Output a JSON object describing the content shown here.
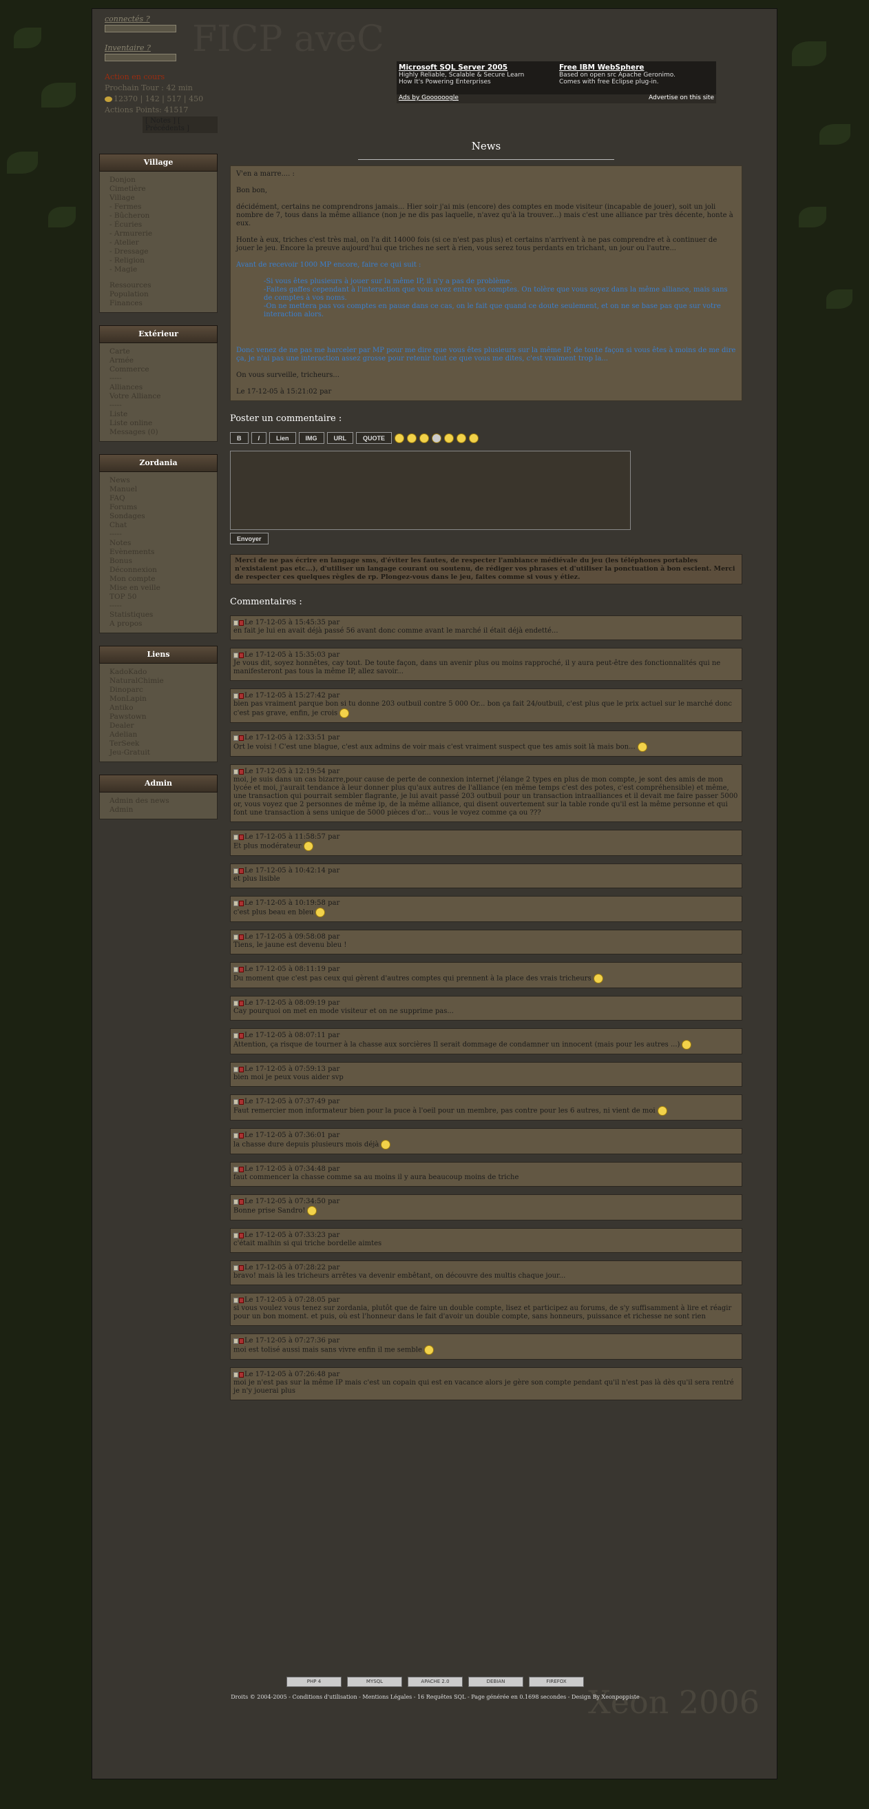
{
  "login": {
    "label1": "connectés ?",
    "label2": "Inventaire ?",
    "event": "Action en cours",
    "line1": "Prochain Tour : 42 min",
    "stats": "12370 | 142 | 517 | 450",
    "line3": "Actions Points: 41517",
    "notes": "[ Notes ] [ Précédents ]"
  },
  "banner": {
    "ad1_title": "Microsoft SQL Server 2005",
    "ad1_l1": "Highly Reliable, Scalable & Secure Learn",
    "ad1_l2": "How It's Powering Enterprises",
    "ad2_title": "Free IBM WebSphere",
    "ad2_l1": "Based on open src Apache Geronimo.",
    "ad2_l2": "Comes with free Eclipse plug-in.",
    "ads_by": "Ads by Goooooogle",
    "advertise": "Advertise on this site"
  },
  "logo": "FICP aveC",
  "sidebar": [
    {
      "title": "Village",
      "items": [
        "Donjon",
        "Cimetière",
        "Village",
        " - Fermes",
        " - Bûcheron",
        " - Écuries",
        " - Armurerie",
        " - Atelier",
        " - Dressage",
        " - Religion",
        " - Magie",
        "",
        "Ressources",
        "Population",
        "Finances"
      ]
    },
    {
      "title": "Extérieur",
      "items": [
        "Carte",
        "Armée",
        "Commerce",
        "-----",
        "Alliances",
        "Votre Alliance",
        "-----",
        "Liste",
        "Liste online",
        "Messages (0)"
      ]
    },
    {
      "title": "Zordania",
      "items": [
        "News",
        "Manuel",
        "FAQ",
        "Forums",
        "Sondages",
        "Chat",
        "-----",
        "Notes",
        "Evènements",
        "Bonus",
        "Déconnexion",
        "Mon compte",
        "Mise en veille",
        "TOP 50",
        "-----",
        "Statistiques",
        "A propos"
      ]
    },
    {
      "title": "Liens",
      "items": [
        "KadoKado",
        "NaturalChimie",
        "Dinoparc",
        "MonLapin",
        "Antiko",
        "Pawstown",
        "Dealer",
        "Adelian",
        "TerSeek",
        "Jeu-Gratuit"
      ]
    },
    {
      "title": "Admin",
      "items": [
        "Admin des news",
        "Admin"
      ]
    }
  ],
  "news": {
    "title": "News",
    "heading": "V'en a marre.... :",
    "p1": "Bon bon,",
    "p2": "décidément, certains ne comprendrons jamais... Hier soir j'ai mis (encore) des comptes en mode visiteur (incapable de jouer), soit un joli nombre de 7, tous dans la même alliance (non je ne dis pas laquelle, n'avez qu'à la trouver...) mais c'est une alliance par très décente, honte à eux.",
    "p3": "Honte à eux, triches c'est très mal, on l'a dit 14000 fois (si ce n'est pas plus) et certains n'arrivent à ne pas comprendre et à continuer de jouer le jeu. Encore la preuve aujourd'hui que triches ne sert à rien, vous serez tous perdants en trichant, un jour ou l'autre...",
    "p4": "Avant de recevoir 1000 MP encore, faire ce qui suit :",
    "p5": "-Si vous êtes plusieurs à jouer sur la même IP, il n'y a pas de problème.",
    "p6": "-Faites gaffes cependant à l'interaction que vous avez entre vos comptes. On tolère que vous soyez dans la même alliance, mais sans de comptes à vos noms.",
    "p7": "-On ne mettera pas vos comptes en pause dans ce cas, on le fait que quand ce doute seulement, et on ne se base pas que sur votre interaction alors.",
    "p8": "Donc venez de ne pas me harceler par MP pour me dire que vous êtes plusieurs sur la même IP, de toute façon si vous êtes à moins de me dire ça, je n'ai pas une interaction assez grosse pour retenir tout ce que vous me dites, c'est vraiment trop la...",
    "p9": "On vous surveille, tricheurs...",
    "p10": "Le 17-12-05 à 15:21:02 par"
  },
  "post": {
    "title": "Poster un commentaire :",
    "buttons": [
      "B",
      "I",
      "Lien",
      "IMG",
      "URL",
      "QUOTE"
    ],
    "send": "Envoyer",
    "warning": "Merci de ne pas écrire en langage sms, d'éviter les fautes, de respecter l'ambiance médiévale du jeu (les téléphones portables n'existaient pas etc...), d'utiliser un langage courant ou soutenu, de rédiger vos phrases et d'utiliser la ponctuation à bon escient. Merci de respecter ces quelques règles de rp. Plongez-vous dans le jeu, faites comme si vous y étiez."
  },
  "comments_title": "Commentaires :",
  "comments": [
    {
      "date": "Le 17-12-05 à 15:45:35 par",
      "text": "en fait je lui en avait déjà passé 56 avant donc comme avant le marché il était déjà endetté...",
      "smiley": false
    },
    {
      "date": "Le 17-12-05 à 15:35:03 par",
      "text": "Je vous dit, soyez honnêtes, cay tout. De toute façon, dans un avenir plus ou moins rapproché, il y aura peut-être des fonctionnalités qui ne manifesteront pas tous la même IP, allez savoir...",
      "smiley": false
    },
    {
      "date": "Le 17-12-05 à 15:27:42 par",
      "text": "bien pas vraiment parque bon si tu donne 203 outbuil contre 5 000 Or... bon ça fait 24/outbuil, c'est plus que le prix actuel sur le marché donc c'est pas grave, enfin, je crois",
      "smiley": true
    },
    {
      "date": "Le 17-12-05 à 12:33:51 par",
      "text": "Ort le voisi ! C'est une blague, c'est aux admins de voir mais c'est vraiment suspect que tes amis soit là mais bon...",
      "smiley": true
    },
    {
      "date": "Le 17-12-05 à 12:19:54 par",
      "text": "moi, je suis dans un cas bizarre,pour cause de perte de connexion internet j'élange 2 types en plus de mon compte, je sont des amis de mon lycée et moi, j'aurait tendance à leur donner plus qu'aux autres de l'alliance (en même temps c'est des potes, c'est compréhensible) et même, une transaction qui pourrait sembler flagrante, je lui avait passé 203 outbuil pour un transaction intraalliances et il devait me faire passer 5000 or, vous voyez que 2 personnes de même ip, de la même alliance, qui disent ouvertement sur la table ronde qu'il est la même personne et qui font une transaction à sens unique de 5000 pièces d'or... vous le voyez comme ça ou ???",
      "smiley": false
    },
    {
      "date": "Le 17-12-05 à 11:58:57 par",
      "text": "Et plus modérateur",
      "smiley": true
    },
    {
      "date": "Le 17-12-05 à 10:42:14 par",
      "text": "et plus lisible",
      "smiley": false
    },
    {
      "date": "Le 17-12-05 à 10:19:58 par",
      "text": "c'est plus beau en bleu",
      "smiley": true
    },
    {
      "date": "Le 17-12-05 à 09:58:08 par",
      "text": "Tiens, le jaune est devenu bleu !",
      "smiley": false
    },
    {
      "date": "Le 17-12-05 à 08:11:19 par",
      "text": "Du moment que c'est pas ceux qui gèrent d'autres comptes qui prennent à la place des vrais tricheurs",
      "smiley": true
    },
    {
      "date": "Le 17-12-05 à 08:09:19 par",
      "text": "Cay pourquoi on met en mode visiteur et on ne supprime pas...",
      "smiley": false
    },
    {
      "date": "Le 17-12-05 à 08:07:11 par",
      "text": "Attention, ça risque de tourner à la chasse aux sorcières Il serait dommage de condamner un innocent (mais pour les autres ...)",
      "smiley": true
    },
    {
      "date": "Le 17-12-05 à 07:59:13 par",
      "text": "bien moi je peux vous aider svp",
      "smiley": false
    },
    {
      "date": "Le 17-12-05 à 07:37:49 par",
      "text": "Faut remercier mon informateur bien pour la puce à l'oeil pour un membre, pas contre pour les 6 autres, ni vient de moi",
      "smiley": true
    },
    {
      "date": "Le 17-12-05 à 07:36:01 par",
      "text": "la chasse dure depuis plusieurs mois déjà",
      "smiley": true
    },
    {
      "date": "Le 17-12-05 à 07:34:48 par",
      "text": "faut commencer la chasse comme sa au moins il y aura beaucoup moins de triche",
      "smiley": false
    },
    {
      "date": "Le 17-12-05 à 07:34:50 par",
      "text": "Bonne prise Sandro!",
      "smiley": true
    },
    {
      "date": "Le 17-12-05 à 07:33:23 par",
      "text": "c'était malhin si qui triche bordelle aimtes",
      "smiley": false
    },
    {
      "date": "Le 17-12-05 à 07:28:22 par",
      "text": "bravo! mais là les tricheurs arrêtes va devenir embêtant, on découvre des multis chaque jour...",
      "smiley": false
    },
    {
      "date": "Le 17-12-05 à 07:28:05 par",
      "text": "si vous voulez vous tenez sur zordania, plutôt que de faire un double compte, lisez et participez au forums, de s'y suffisamment à lire et réagir pour un bon moment. et puis, où est l'honneur dans le fait d'avoir un double compte, sans honneurs, puissance et richesse ne sont rien",
      "smiley": false
    },
    {
      "date": "Le 17-12-05 à 07:27:36 par",
      "text": "moi est tolisé aussi mais sans vivre enfin il me semble",
      "smiley": true
    },
    {
      "date": "Le 17-12-05 à 07:26:48 par",
      "text": "moi je n'est pas sur la même IP mais c'est un copain qui est en vacance alors je gère son compte pendant qu'il n'est pas là dès qu'il sera rentré je n'y jouerai plus",
      "smiley": false
    }
  ],
  "footer": {
    "badges": [
      "PHP 4",
      "MYSQL",
      "APACHE 2.0",
      "DEBIAN",
      "FIREFOX"
    ],
    "text": "Droits © 2004-2005 - Conditions d'utilisation - Mentions Légales - 16 Requêtes SQL - Page générée en 0.1698 secondes - Design By Xeonpoppiste",
    "watermark": "Xeon 2006"
  },
  "colors": {
    "background": "#1c2212",
    "frame": "#393630",
    "panel": "#625743",
    "link_blue": "#3a7fd0"
  }
}
